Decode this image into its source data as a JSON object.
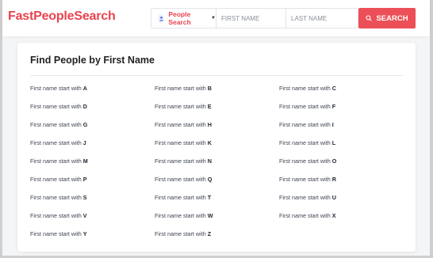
{
  "header": {
    "logo": "FastPeopleSearch",
    "search_type": "People Search",
    "first_name_placeholder": "FIRST NAME",
    "last_name_placeholder": "LAST NAME",
    "search_button": "SEARCH"
  },
  "card": {
    "title": "Find People by First Name",
    "link_prefix": "First name start with",
    "letters": [
      "A",
      "B",
      "C",
      "D",
      "E",
      "F",
      "G",
      "H",
      "I",
      "J",
      "K",
      "L",
      "M",
      "N",
      "O",
      "P",
      "Q",
      "R",
      "S",
      "T",
      "U",
      "V",
      "W",
      "X",
      "Y",
      "Z"
    ]
  },
  "colors": {
    "brand": "#e8434f",
    "button": "#ec4f58",
    "text": "#3d4350",
    "background": "#f4f5f7"
  }
}
